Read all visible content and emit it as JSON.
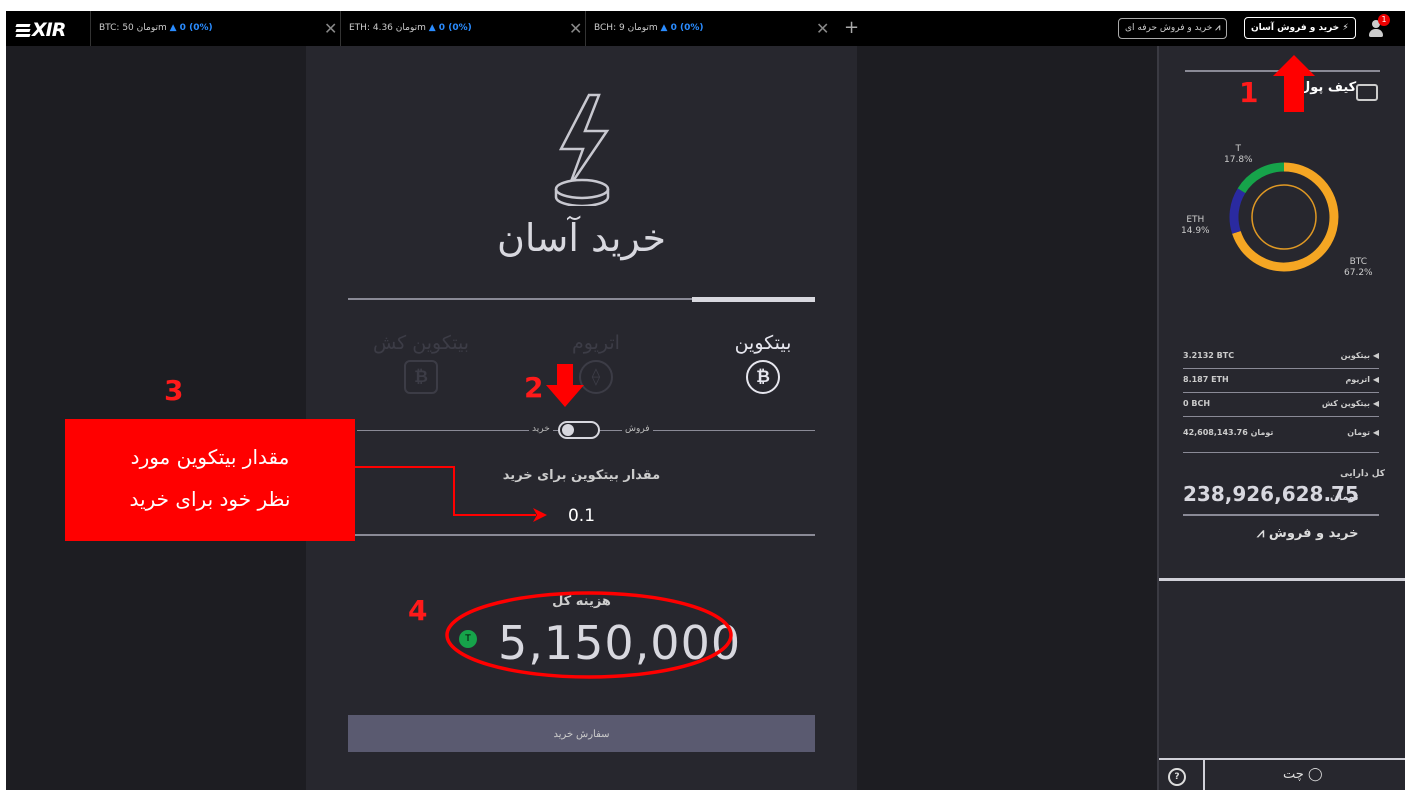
{
  "brand": {
    "logo": "XIR"
  },
  "tabs": [
    {
      "label": "BTC: تومان 50m",
      "change": "▲ 0 (0%)"
    },
    {
      "label": "ETH: تومان 4.36m",
      "change": "▲ 0 (0%)"
    },
    {
      "label": "BCH: تومان 9m",
      "change": "▲ 0 (0%)"
    }
  ],
  "topbar": {
    "add_tab": "+",
    "close": "✕",
    "pro_trade": "خرید و فروش حرفه ای",
    "easy_trade": "خرید و فروش آسان",
    "notification_count": "1"
  },
  "main": {
    "title": "خرید آسان",
    "coins": [
      {
        "label": "بیتکوین",
        "symbol": "₿",
        "active": true
      },
      {
        "label": "اتریوم",
        "symbol": "⟠",
        "active": false
      },
      {
        "label": "بیتکوین کش",
        "symbol": "₿",
        "active": false
      }
    ],
    "toggle": {
      "buy": "خرید",
      "sell": "فروش"
    },
    "amount_label": "مقدار بیتکوین برای خرید",
    "amount_value": "0.1",
    "cost_label": "هزینه کل",
    "cost_value": "5,150,000",
    "currency_badge": "T",
    "order_button": "سفارش خرید"
  },
  "wallet": {
    "title": "کیف پول",
    "pie": [
      {
        "name": "T",
        "percent": "17.8%",
        "color": "#16a34a"
      },
      {
        "name": "ETH",
        "percent": "14.9%",
        "color": "#2a2aa0"
      },
      {
        "name": "BTC",
        "percent": "67.2%",
        "color": "#f5a623"
      }
    ],
    "balances": [
      {
        "name": "بیتکوین",
        "value": "3.2132 BTC"
      },
      {
        "name": "اتریوم",
        "value": "8.187 ETH"
      },
      {
        "name": "بیتکوین کش",
        "value": "0 BCH"
      },
      {
        "name": "تومان",
        "value": "42,608,143.76 تومان"
      }
    ],
    "total_label": "کل دارایی",
    "total_value": "238,926,628.75",
    "total_currency": "تومان",
    "trade_link": "خرید و فروش"
  },
  "footer": {
    "chat": "چت",
    "help": "?"
  },
  "annotations": {
    "n1": "1",
    "n2": "2",
    "n3": "3",
    "n4": "4",
    "callout_line1": "مقدار بیتکوین مورد",
    "callout_line2": "نظر خود برای خرید"
  },
  "colors": {
    "background": "#1d1d22",
    "panel": "#27272e",
    "annotation": "#ff0000",
    "link_blue": "#2a8cff"
  }
}
